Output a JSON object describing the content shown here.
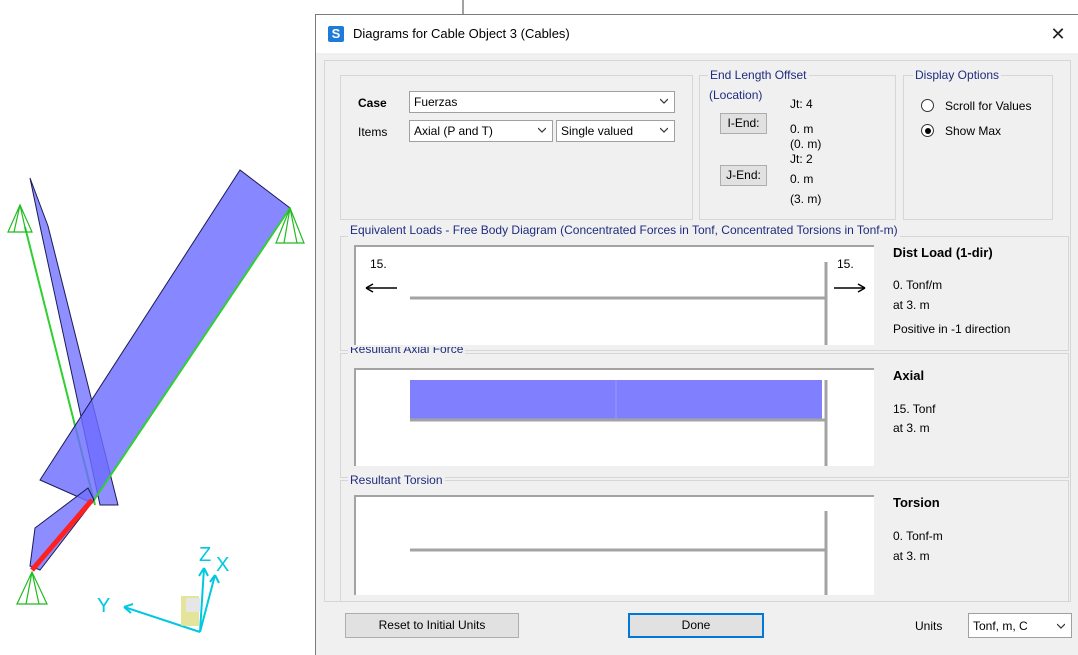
{
  "dialog": {
    "title": "Diagrams for Cable Object 3  (Cables)",
    "app_icon": "S",
    "close_glyph": "✕"
  },
  "case_group": {
    "case_label": "Case",
    "case_value": "Fuerzas",
    "items_label": "Items",
    "items_value": "Axial (P and T)",
    "valued_value": "Single valued"
  },
  "end_offset": {
    "title": "End Length Offset",
    "location_label": "(Location)",
    "i_end_button": "I-End:",
    "i_joint": "Jt:  4",
    "i_offset": "0. m",
    "i_location": "(0. m)",
    "j_end_button": "J-End:",
    "j_joint": "Jt:  2",
    "j_offset": "0. m",
    "j_location": "(3. m)"
  },
  "display_options": {
    "title": "Display Options",
    "option_scroll": "Scroll for Values",
    "option_show_max": "Show Max",
    "selected": "Show Max"
  },
  "fbd": {
    "title": "Equivalent Loads - Free Body Diagram  (Concentrated Forces in Tonf, Concentrated Torsions in Tonf-m)",
    "left_force": "15.",
    "right_force": "15.",
    "info_title": "Dist Load (1-dir)",
    "info_value": "0. Tonf/m",
    "info_at": "at 3. m",
    "info_note": "Positive in -1 direction"
  },
  "axial": {
    "title": "Resultant Axial Force",
    "info_title": "Axial",
    "info_value": "15. Tonf",
    "info_at": "at 3. m",
    "value_fraction": 1.0
  },
  "torsion": {
    "title": "Resultant Torsion",
    "info_title": "Torsion",
    "info_value": "0. Tonf-m",
    "info_at": "at 3. m"
  },
  "footer": {
    "reset_button": "Reset to Initial Units",
    "done_button": "Done",
    "units_label": "Units",
    "units_value": "Tonf, m, C"
  },
  "axes_triad": {
    "x": "X",
    "y": "Y",
    "z": "Z"
  },
  "colors": {
    "member_fill": "#7070ff",
    "diagram_fill": "#8080ff",
    "support": "#33cc33",
    "cable": "#ff2020",
    "triad": "#00c8e0",
    "group_title": "#1f2c7e"
  },
  "icons": [
    "app-icon",
    "close-icon",
    "chevron-down-icon",
    "arrow-left-icon",
    "arrow-right-icon",
    "support-icon"
  ]
}
